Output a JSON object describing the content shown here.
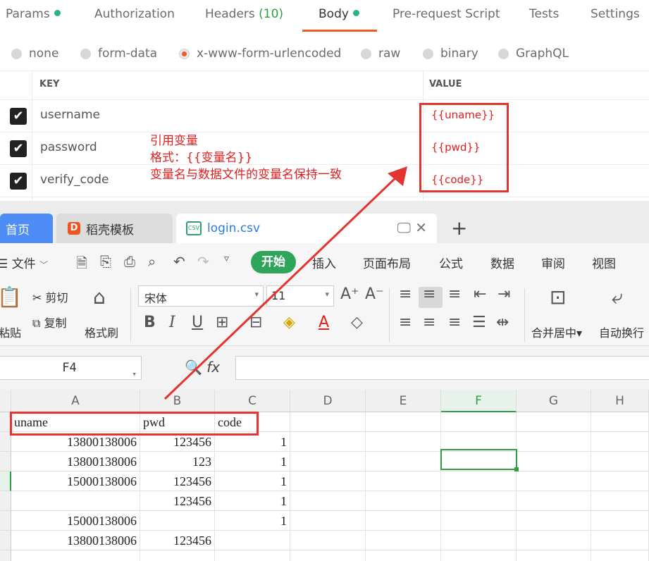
{
  "postman": {
    "tabs": [
      {
        "label": "Params",
        "dot": true
      },
      {
        "label": "Authorization"
      },
      {
        "label": "Headers",
        "count": "(10)"
      },
      {
        "label": "Body",
        "dot": true,
        "active": true
      },
      {
        "label": "Pre-request Script"
      },
      {
        "label": "Tests"
      },
      {
        "label": "Settings"
      }
    ],
    "body_types": [
      "none",
      "form-data",
      "x-www-form-urlencoded",
      "raw",
      "binary",
      "GraphQL"
    ],
    "selected_body_type": "x-www-form-urlencoded",
    "table": {
      "key_header": "KEY",
      "value_header": "VALUE",
      "rows": [
        {
          "key": "username",
          "value": "{{uname}}",
          "checked": true
        },
        {
          "key": "password",
          "value": "{{pwd}}",
          "checked": true
        },
        {
          "key": "verify_code",
          "value": "{{code}}",
          "checked": true
        }
      ]
    },
    "annotation": {
      "line1": "引用变量",
      "line2": "格式：{{变量名}}",
      "line3": "变量名与数据文件的变量名保持一致"
    }
  },
  "wps": {
    "tabs": {
      "home": "首页",
      "docer": "稻壳模板",
      "file": "login.csv",
      "file_icon": "CSV"
    },
    "menu": {
      "file": "文件",
      "start": "开始",
      "insert": "插入",
      "page_layout": "页面布局",
      "formula": "公式",
      "data": "数据",
      "review": "审阅",
      "view": "视图"
    },
    "ribbon": {
      "cut": "剪切",
      "copy": "复制",
      "paste": "粘贴",
      "format_painter": "格式刷",
      "font": "宋体",
      "font_size": "11",
      "merge_center": "合并居中",
      "auto_wrap": "自动换行",
      "bold": "B",
      "italic": "I",
      "underline": "U",
      "font_color": "A"
    },
    "name_box": "F4",
    "fx": "fx",
    "columns": [
      "A",
      "B",
      "C",
      "D",
      "E",
      "F",
      "G",
      "H"
    ],
    "selected_column": "F",
    "rows": [
      [
        "uname",
        "pwd",
        "code"
      ],
      [
        "13800138006",
        "123456",
        "1"
      ],
      [
        "13800138006",
        "123",
        "1"
      ],
      [
        "15000138006",
        "123456",
        "1"
      ],
      [
        "",
        "123456",
        "1"
      ],
      [
        "15000138006",
        "",
        "1"
      ],
      [
        "13800138006",
        "123456",
        ""
      ]
    ]
  },
  "colors": {
    "accent_orange": "#ef5b25",
    "annotation_red": "#e02020",
    "wps_green": "#2fa55b",
    "wps_blue": "#4e8df5"
  }
}
